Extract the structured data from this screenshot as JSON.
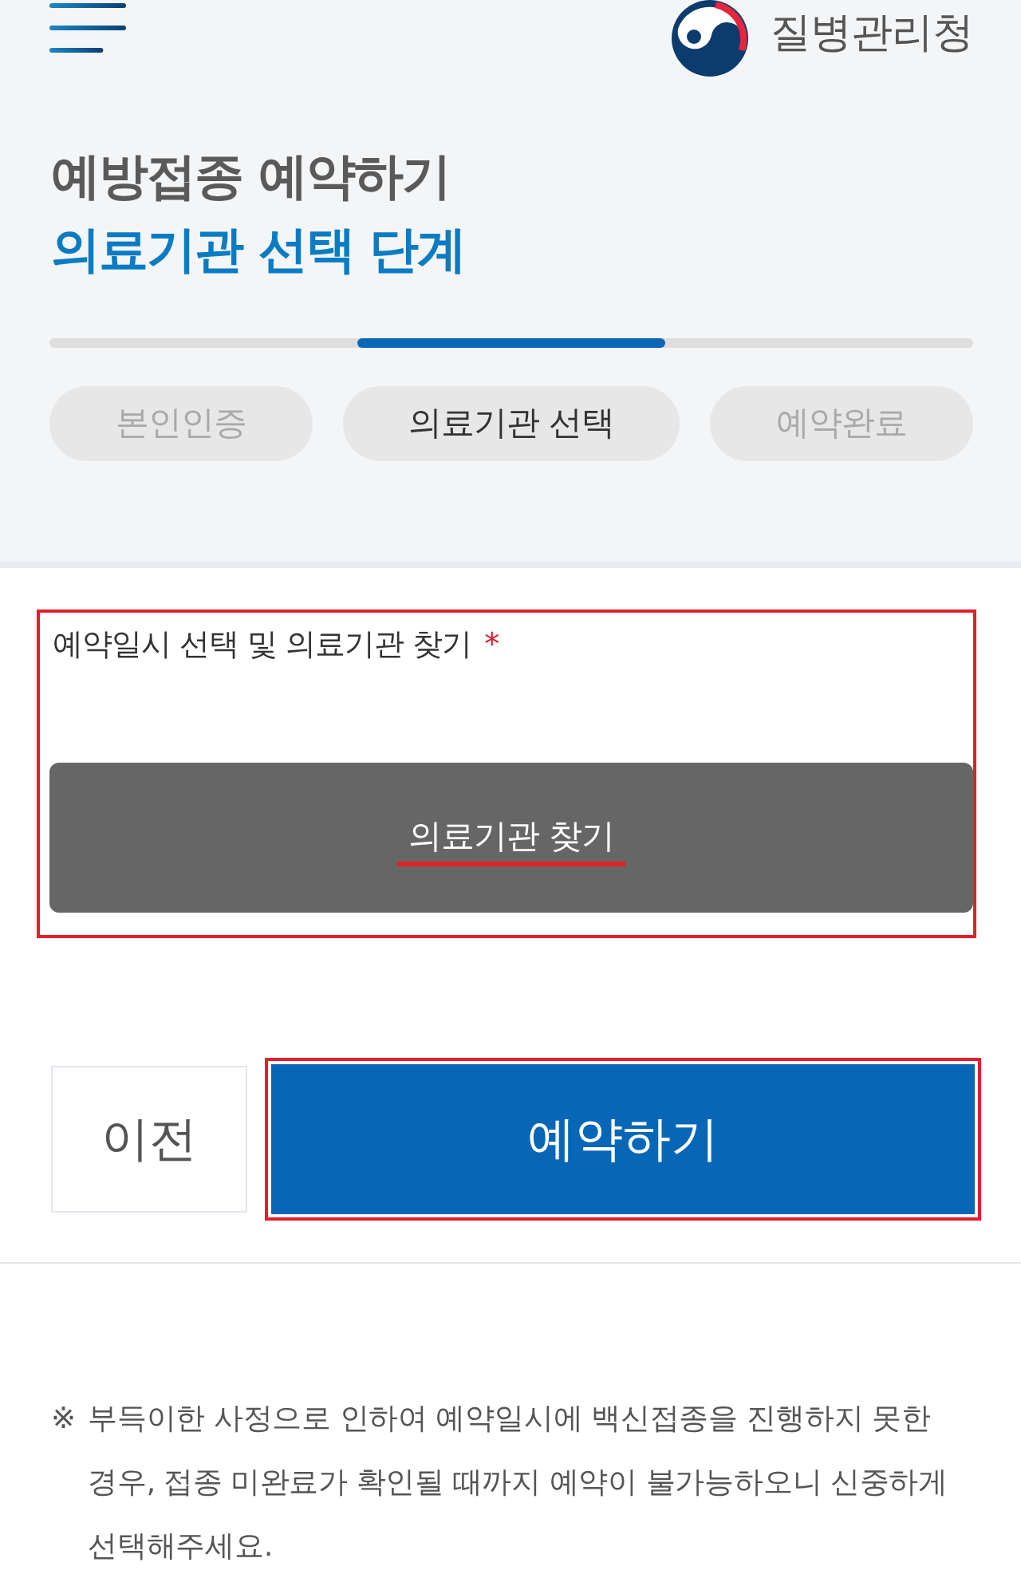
{
  "header": {
    "agency_name": "질병관리청"
  },
  "page_title": "예방접종 예약하기",
  "step_title": "의료기관 선택 단계",
  "steps": [
    {
      "label": "본인인증",
      "selected": false
    },
    {
      "label": "의료기관 선택",
      "selected": true
    },
    {
      "label": "예약완료",
      "selected": false
    }
  ],
  "field": {
    "label": "예약일시 선택 및 의료기관 찾기",
    "required_mark": "*",
    "highlighted": true,
    "button": {
      "label": "의료기관 찾기",
      "underlined": true
    }
  },
  "actions": [
    {
      "label": "이전",
      "kind": "secondary",
      "highlighted": false
    },
    {
      "label": "예약하기",
      "kind": "primary",
      "highlighted": true
    }
  ],
  "notice": {
    "symbol": "※",
    "text": "부득이한 사정으로 인하여 예약일시에 백신접종을 진행하지 못한 경우, 접종 미완료가 확인될 때까지 예약이 불가능하오니 신중하게 선택해주세요."
  }
}
